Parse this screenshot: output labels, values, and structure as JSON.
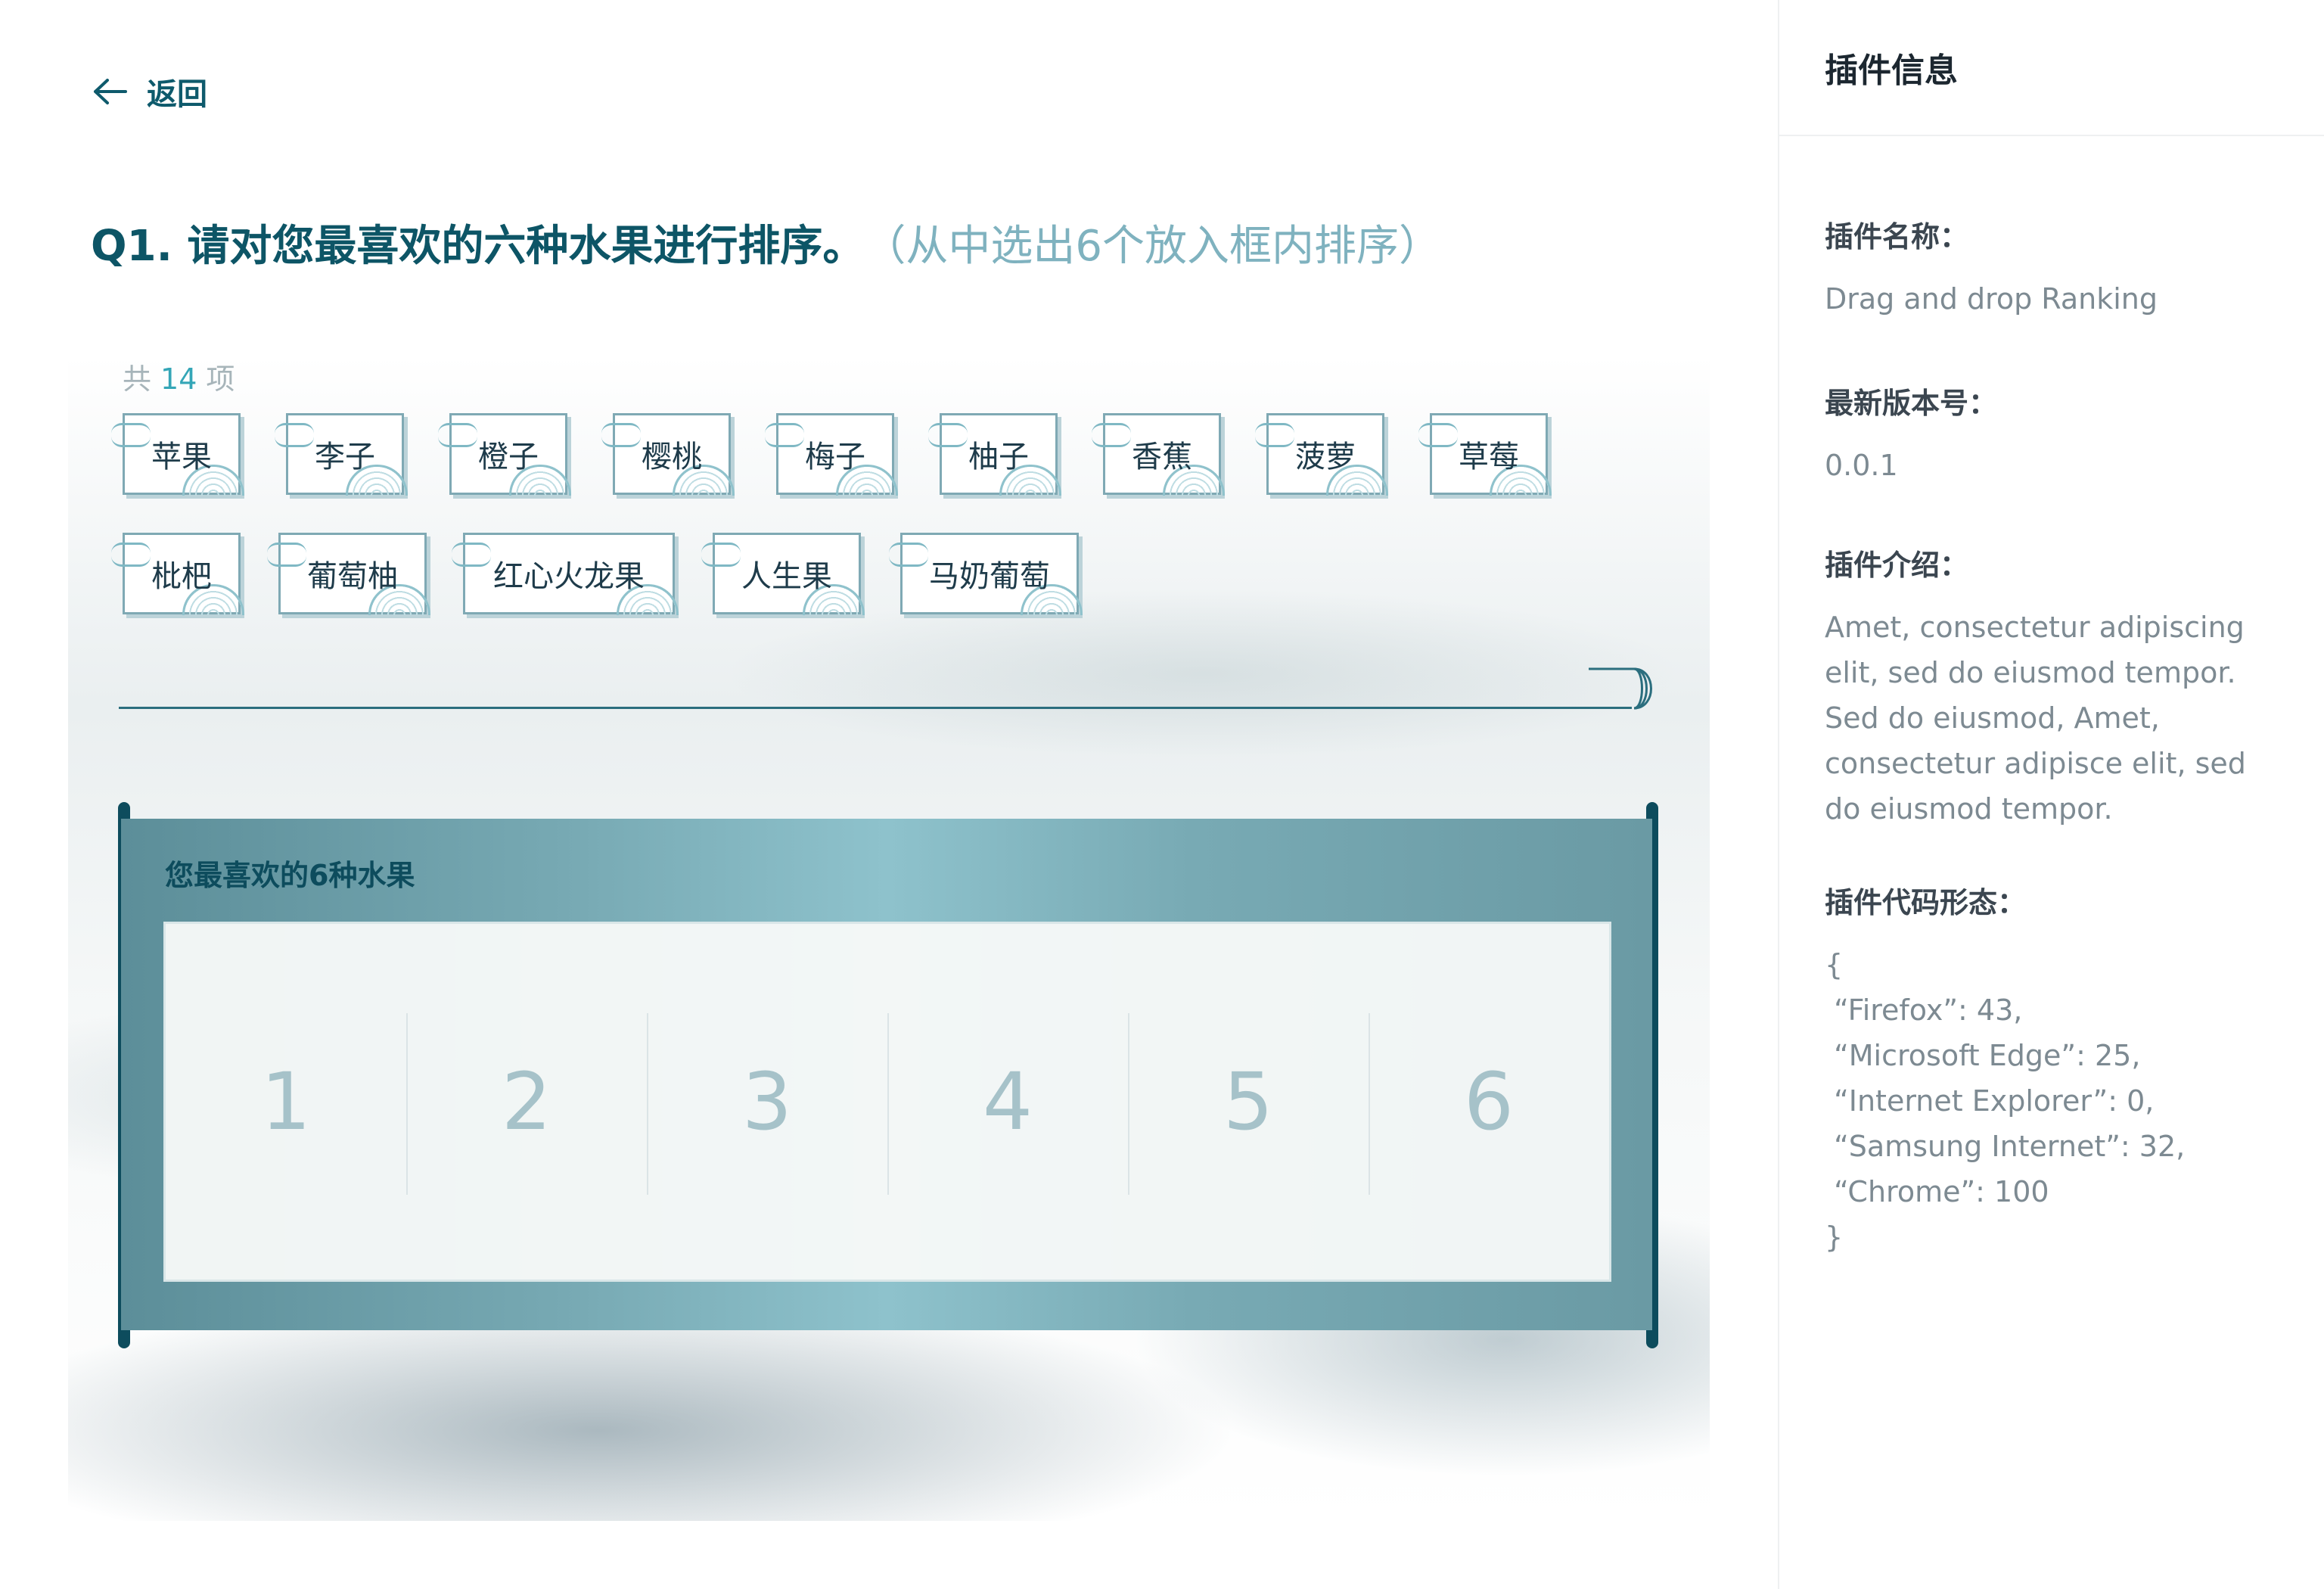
{
  "nav": {
    "back_label": "返回"
  },
  "question": {
    "title": "Q1. 请对您最喜欢的六种水果进行排序。",
    "hint": "（从中选出6个放入框内排序）"
  },
  "pool": {
    "count_prefix": "共",
    "count": "14",
    "count_suffix": "项",
    "items": [
      "苹果",
      "李子",
      "橙子",
      "樱桃",
      "梅子",
      "柚子",
      "香蕉",
      "菠萝",
      "草莓",
      "枇杷",
      "葡萄柚",
      "红心火龙果",
      "人生果",
      "马奶葡萄"
    ]
  },
  "ranking": {
    "title": "您最喜欢的6种水果",
    "slots": [
      "1",
      "2",
      "3",
      "4",
      "5",
      "6"
    ]
  },
  "sidebar": {
    "title": "插件信息",
    "name_label": "插件名称：",
    "name_value": "Drag and drop Ranking",
    "version_label": "最新版本号：",
    "version_value": "0.0.1",
    "intro_label": "插件介绍：",
    "intro_lines": [
      "Amet, consectetur adipiscing",
      "elit, sed do eiusmod tempor.",
      "Sed do eiusmod, Amet,",
      "consectetur adipisce elit, sed",
      "do eiusmod tempor."
    ],
    "code_label": "插件代码形态：",
    "code_lines": [
      "{",
      " “Firefox”: 43,",
      " “Microsoft Edge”: 25,",
      " “Internet Explorer”: 0,",
      " “Samsung Internet”: 32,",
      " “Chrome”: 100",
      "}"
    ]
  },
  "colors": {
    "accent": "#0d5566",
    "hint": "#7fb2bf",
    "count": "#34a6b7",
    "panel": "#78aab4"
  }
}
